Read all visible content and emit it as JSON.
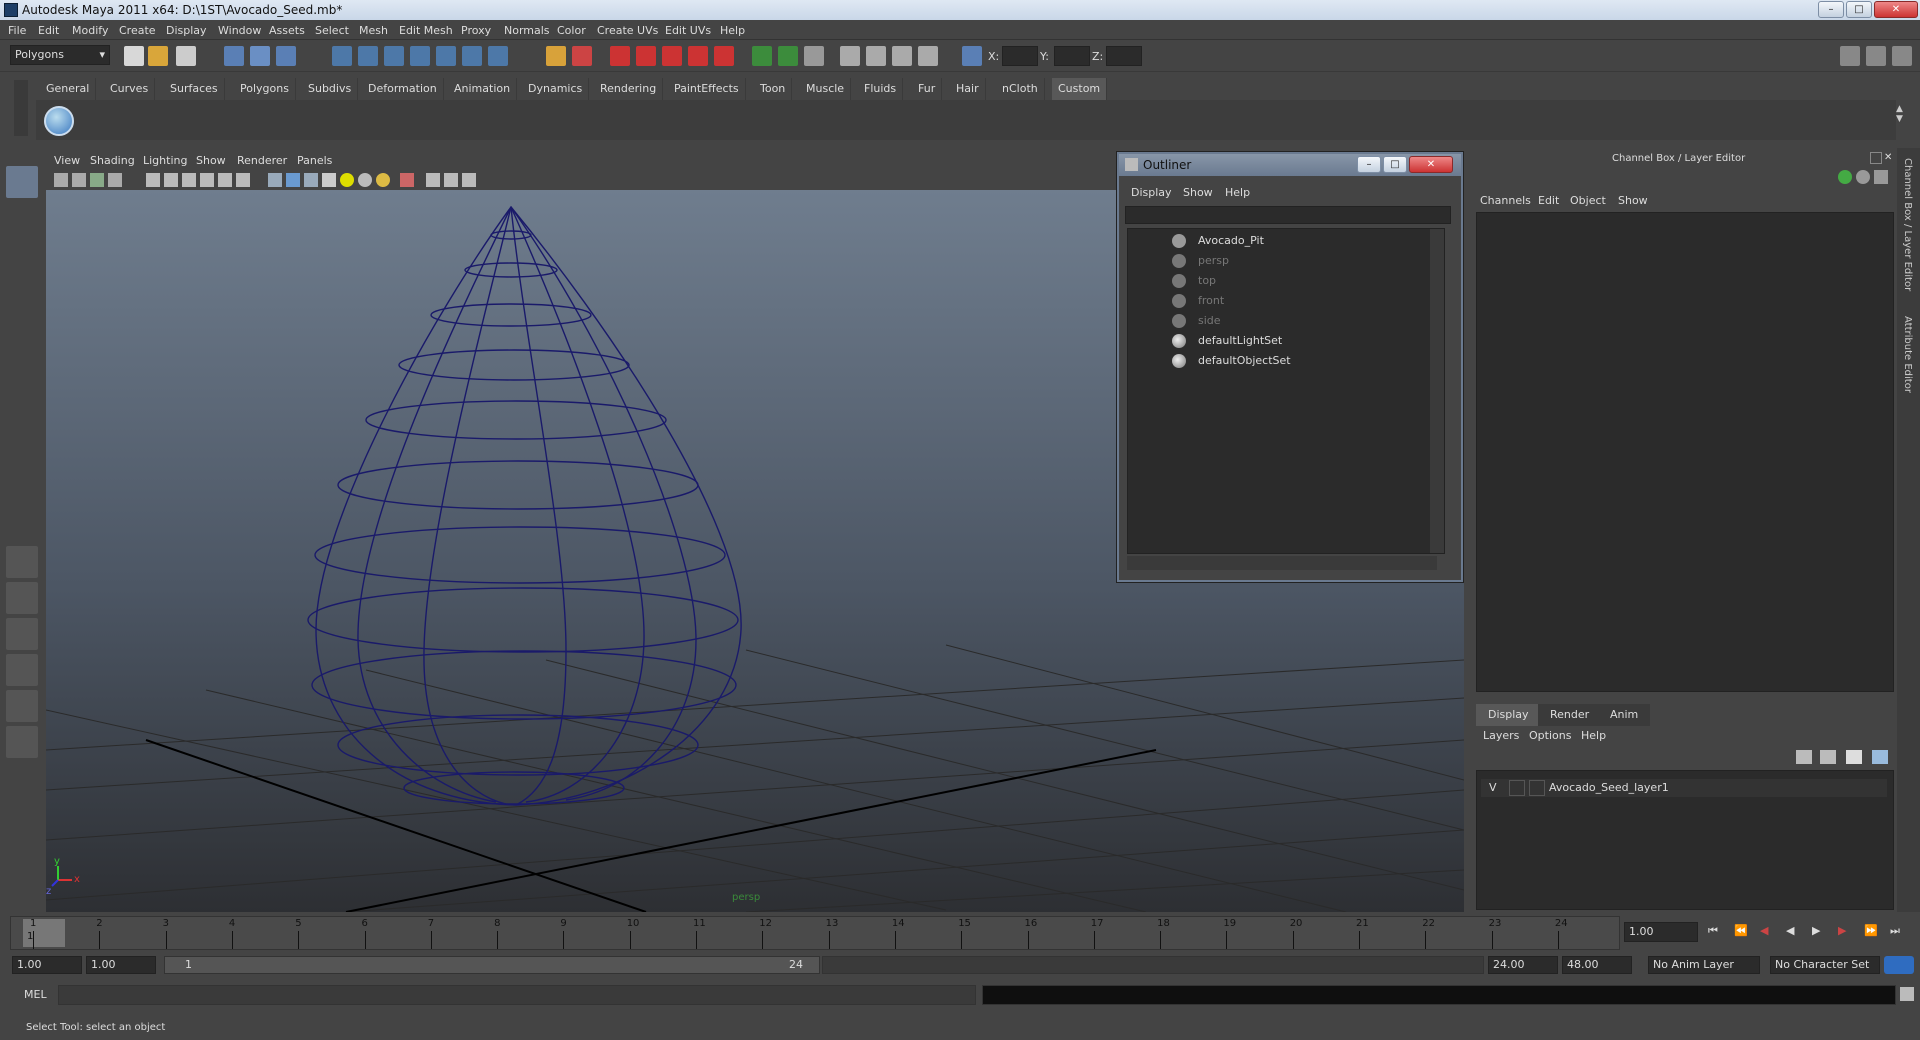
{
  "window": {
    "title": "Autodesk Maya 2011 x64: D:\\1ST\\Avocado_Seed.mb*",
    "controls": [
      "–",
      "□",
      "✕"
    ]
  },
  "menubar": [
    "File",
    "Edit",
    "Modify",
    "Create",
    "Display",
    "Window",
    "Assets",
    "Select",
    "Mesh",
    "Edit Mesh",
    "Proxy",
    "Normals",
    "Color",
    "Create UVs",
    "Edit UVs",
    "Help"
  ],
  "statusline": {
    "menuset": "Polygons",
    "x_label": "X:",
    "y_label": "Y:",
    "z_label": "Z:"
  },
  "shelf": {
    "tabs": [
      "General",
      "Curves",
      "Surfaces",
      "Polygons",
      "Subdivs",
      "Deformation",
      "Animation",
      "Dynamics",
      "Rendering",
      "PaintEffects",
      "Toon",
      "Muscle",
      "Fluids",
      "Fur",
      "Hair",
      "nCloth",
      "Custom"
    ],
    "active_tab": "Custom"
  },
  "viewport": {
    "menu": [
      "View",
      "Shading",
      "Lighting",
      "Show",
      "Renderer",
      "Panels"
    ],
    "camera_label": "persp",
    "axis_labels": [
      "x",
      "y",
      "z"
    ]
  },
  "outliner": {
    "title": "Outliner",
    "menu": [
      "Display",
      "Show",
      "Help"
    ],
    "items": [
      {
        "label": "Avocado_Pit",
        "dim": false
      },
      {
        "label": "persp",
        "dim": true
      },
      {
        "label": "top",
        "dim": true
      },
      {
        "label": "front",
        "dim": true
      },
      {
        "label": "side",
        "dim": true
      },
      {
        "label": "defaultLightSet",
        "dim": false
      },
      {
        "label": "defaultObjectSet",
        "dim": false
      }
    ]
  },
  "channelbox": {
    "title": "Channel Box / Layer Editor",
    "menu": [
      "Channels",
      "Edit",
      "Object",
      "Show"
    ],
    "layer_tabs": [
      "Display",
      "Render",
      "Anim"
    ],
    "layer_menu": [
      "Layers",
      "Options",
      "Help"
    ],
    "layer": {
      "visibility": "V",
      "name": "Avocado_Seed_layer1"
    },
    "side_tabs": [
      "Channel Box / Layer Editor",
      "Attribute Editor"
    ]
  },
  "timeslider": {
    "frames": [
      "1",
      "2",
      "3",
      "4",
      "5",
      "6",
      "7",
      "8",
      "9",
      "10",
      "11",
      "12",
      "13",
      "14",
      "15",
      "16",
      "17",
      "18",
      "19",
      "20",
      "21",
      "22",
      "23",
      "24"
    ],
    "current_frame": "1.00",
    "current_marker": "1"
  },
  "rangebar": {
    "start": "1.00",
    "start_inner": "1.00",
    "range_start_label": "1",
    "range_end_label": "24",
    "end_inner": "24.00",
    "end": "48.00",
    "anim_layer": "No Anim Layer",
    "character_set": "No Character Set"
  },
  "cmdline": {
    "label": "MEL"
  },
  "helpline": {
    "text": "Select Tool: select an object"
  }
}
